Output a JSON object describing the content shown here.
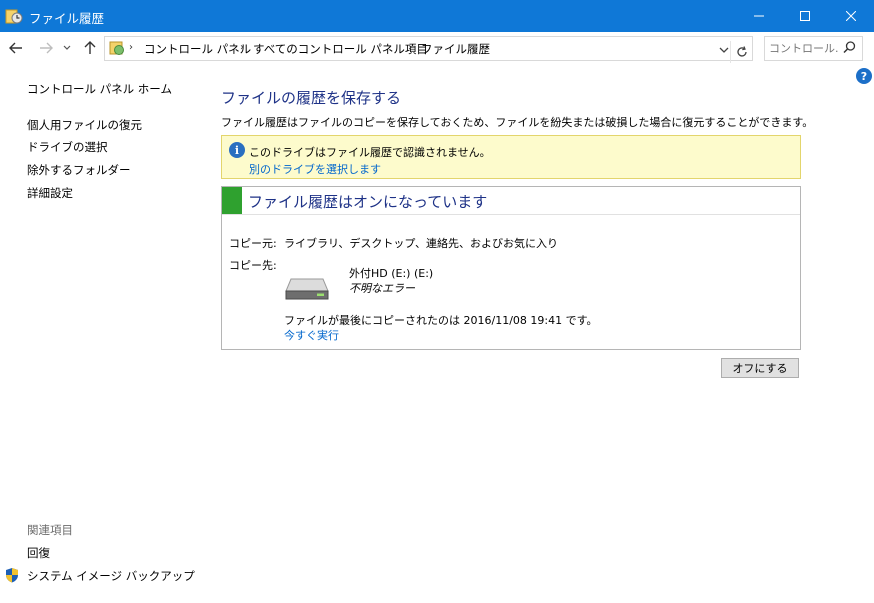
{
  "window": {
    "title": "ファイル履歴",
    "accent": "#0f78d7"
  },
  "address": {
    "breadcrumbs": [
      "コントロール パネル",
      "すべてのコントロール パネル項目",
      "ファイル履歴"
    ],
    "separator": "›",
    "search_placeholder": "コントロール..."
  },
  "sidebar": {
    "home": "コントロール パネル ホーム",
    "links": [
      "個人用ファイルの復元",
      "ドライブの選択",
      "除外するフォルダー",
      "詳細設定"
    ],
    "related_header": "関連項目",
    "related_links": [
      "回復",
      "システム イメージ バックアップ"
    ]
  },
  "main": {
    "heading": "ファイルの履歴を保存する",
    "description": "ファイル履歴はファイルのコピーを保存しておくため、ファイルを紛失または破損した場合に復元することができます。",
    "warning": {
      "text": "このドライブはファイル履歴で認識されません。",
      "link": "別のドライブを選択します"
    },
    "status": {
      "title": "ファイル履歴はオンになっています",
      "status_color": "#2fa12f",
      "copy_from_label": "コピー元:",
      "copy_from_value": "ライブラリ、デスクトップ、連絡先、およびお気に入り",
      "copy_to_label": "コピー先:",
      "drive_name": "外付HD (E:) (E:)",
      "drive_status": "不明なエラー",
      "last_copy": "ファイルが最後にコピーされたのは 2016/11/08 19:41 です。",
      "run_now": "今すぐ実行"
    },
    "off_button": "オフにする"
  },
  "help": "?"
}
